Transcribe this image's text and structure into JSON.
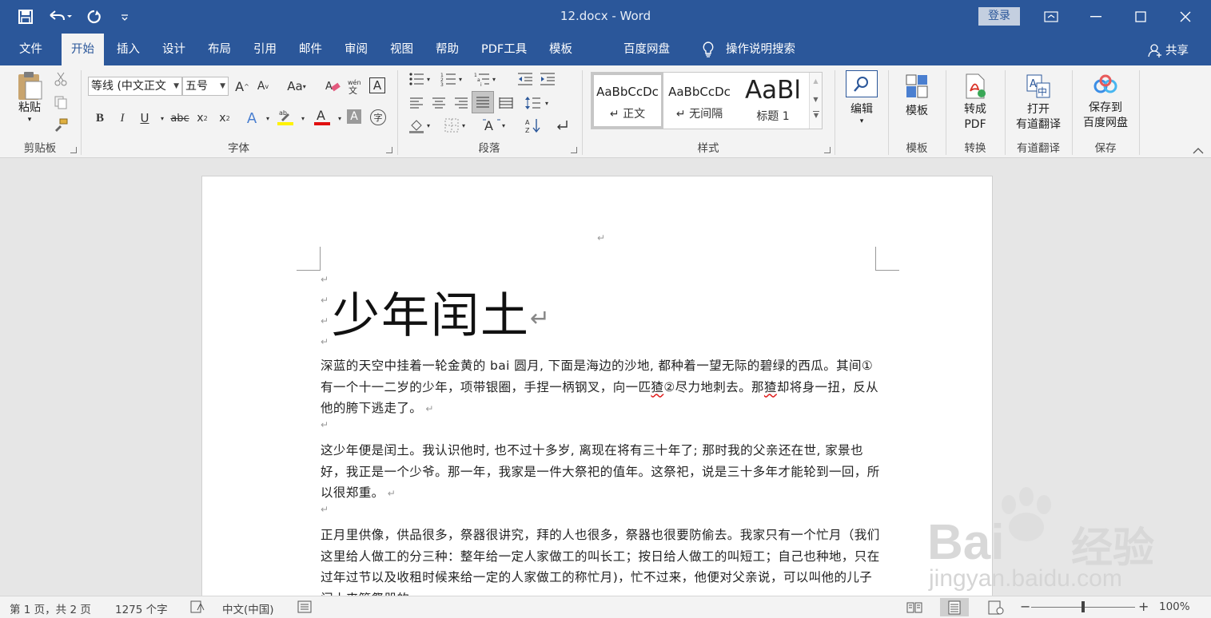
{
  "window": {
    "title": "12.docx  -  Word",
    "login": "登录"
  },
  "tabs": [
    "文件",
    "开始",
    "插入",
    "设计",
    "布局",
    "引用",
    "邮件",
    "审阅",
    "视图",
    "帮助",
    "PDF工具",
    "模板",
    "百度网盘",
    "操作说明搜索"
  ],
  "share": "共享",
  "ribbon": {
    "clipboard": {
      "paste": "粘贴",
      "label": "剪贴板"
    },
    "font": {
      "name": "等线 (中文正文",
      "size": "五号",
      "label": "字体"
    },
    "paragraph": {
      "label": "段落"
    },
    "styles": {
      "label": "样式",
      "items": [
        {
          "sample": "AaBbCcDc",
          "name": "↵ 正文"
        },
        {
          "sample": "AaBbCcDc",
          "name": "↵ 无间隔"
        },
        {
          "sample": "AaBl",
          "name": "标题 1"
        }
      ]
    },
    "editing": {
      "button": "编辑"
    },
    "template": {
      "button": "模板",
      "label": "模板"
    },
    "convert": {
      "button_line1": "转成",
      "button_line2": "PDF",
      "label": "转换"
    },
    "youdao": {
      "button_line1": "打开",
      "button_line2": "有道翻译",
      "label": "有道翻译"
    },
    "save": {
      "button_line1": "保存到",
      "button_line2": "百度网盘",
      "label": "保存"
    }
  },
  "document": {
    "title": "少年闰土",
    "paragraphs": [
      {
        "pre": "深蓝的天空中挂着一轮金黄的 bai 圆月, 下面是海边的沙地, 都种着一望无际的碧绿的西瓜。其间①有一个十一二岁的少年，项带银圈，手捏一柄钢叉，向一匹",
        "err1": "猹",
        "mid": "②尽力地刺去。那",
        "err2": "猹",
        "post": "却将身一扭，反从他的胯下逃走了。"
      },
      {
        "text": "这少年便是闰土。我认识他时, 也不过十多岁, 离现在将有三十年了; 那时我的父亲还在世, 家景也好，我正是一个少爷。那一年，我家是一件大祭祀的值年。这祭祀，说是三十多年才能轮到一回，所以很郑重。"
      },
      {
        "text": "正月里供像，供品很多，祭器很讲究，拜的人也很多，祭器也很要防偷去。我家只有一个忙月（我们这里给人做工的分三种：整年给一定人家做工的叫长工；按日给人做工的叫短工；自己也种地，只在过年过节以及收租时候来给一定的人家做工的称忙月)，忙不过来，他便对父亲说，可以叫他的儿子闰土来管祭器的。"
      }
    ]
  },
  "watermark": {
    "brand": "Bai",
    "brand2": "经验",
    "url": "jingyan.baidu.com"
  },
  "status": {
    "page": "第 1 页，共 2 页",
    "words": "1275 个字",
    "language": "中文(中国)",
    "zoom": "100%"
  }
}
